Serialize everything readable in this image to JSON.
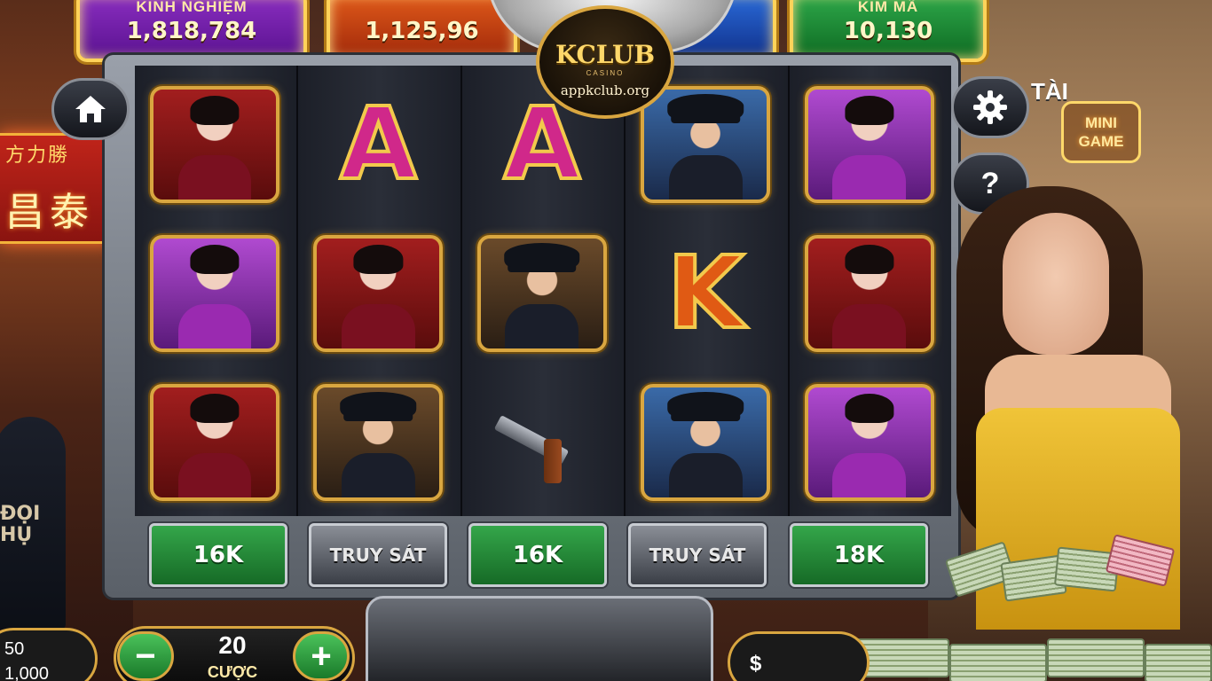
{
  "counters": [
    {
      "label": "KINH NGHIỆM",
      "value": "1,818,784",
      "color": "#8a2ec0"
    },
    {
      "label": "",
      "value": "1,125,96",
      "color": "#e05a1a"
    },
    {
      "label": "",
      "value": "",
      "color": "#2a6ad8"
    },
    {
      "label": "KIM MÃ",
      "value": "10,130",
      "color": "#2ea84a"
    }
  ],
  "logo": {
    "brand": "KCLUB",
    "sub": "CASINO",
    "url": "appkclub.org"
  },
  "side_buttons": {
    "home_icon": "home-icon",
    "settings_icon": "gear-icon",
    "help_icon": "question-icon",
    "help_glyph": "?"
  },
  "mini_game": {
    "tai": "TÀI",
    "line1": "MINI",
    "line2": "GAME"
  },
  "reels": [
    [
      "lady-red",
      "lady-purple",
      "lady-red"
    ],
    [
      "A",
      "lady-red",
      "man-hat"
    ],
    [
      "A",
      "man-hat",
      "pistol"
    ],
    [
      "man-blue",
      "K",
      "man-blue"
    ],
    [
      "lady-purple",
      "lady-red",
      "lady-purple"
    ]
  ],
  "reel_labels": [
    "16K",
    "TRUY SÁT",
    "16K",
    "TRUY SÁT",
    "18K"
  ],
  "bet": {
    "minus": "−",
    "plus": "+",
    "value": "20",
    "label": "CƯỢC"
  },
  "left_info": {
    "line1": "50",
    "line2": "1,000"
  },
  "balance": {
    "currency": "$"
  },
  "shop_sign": {
    "top": "方力勝",
    "big": "昌泰"
  },
  "side_text": {
    "line1": "ĐỌI",
    "line2": "HỤ"
  }
}
